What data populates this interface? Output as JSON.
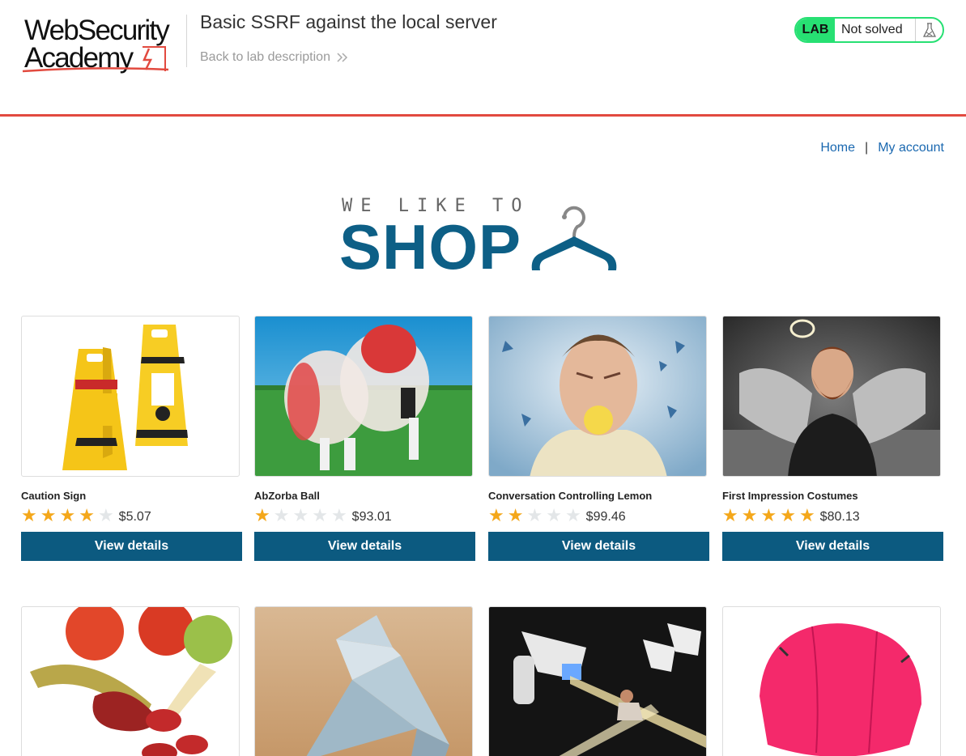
{
  "header": {
    "logo_line1": "WebSecurity",
    "logo_line2": "Academy",
    "lab_title": "Basic SSRF against the local server",
    "back_link": "Back to lab description",
    "lab_badge": "LAB",
    "lab_status": "Not solved"
  },
  "nav": {
    "home": "Home",
    "separator": "|",
    "my_account": "My account"
  },
  "banner": {
    "tagline": "WE LIKE TO",
    "shop": "SHOP"
  },
  "colors": {
    "accent_red": "#e24a3f",
    "lab_green": "#27e073",
    "button_blue": "#0c5a80",
    "link_blue": "#1a68b0",
    "star_gold": "#f4a71a"
  },
  "products": [
    {
      "name": "Caution Sign",
      "rating": 4,
      "price": "$5.07",
      "button": "View details",
      "image": "yellow-caution-signs"
    },
    {
      "name": "AbZorba Ball",
      "rating": 1,
      "price": "$93.01",
      "button": "View details",
      "image": "bubble-football"
    },
    {
      "name": "Conversation Controlling Lemon",
      "rating": 2,
      "price": "$99.46",
      "button": "View details",
      "image": "man-with-lemon"
    },
    {
      "name": "First Impression Costumes",
      "rating": 5,
      "price": "$80.13",
      "button": "View details",
      "image": "angel-costume"
    },
    {
      "name": "",
      "rating": 0,
      "price": "",
      "button": "",
      "image": "sausage-and-banana"
    },
    {
      "name": "",
      "rating": 0,
      "price": "",
      "button": "",
      "image": "origami-money-bird"
    },
    {
      "name": "",
      "rating": 0,
      "price": "",
      "button": "",
      "image": "laser-tag-guns"
    },
    {
      "name": "",
      "rating": 0,
      "price": "",
      "button": "",
      "image": "pink-umbrella"
    }
  ]
}
